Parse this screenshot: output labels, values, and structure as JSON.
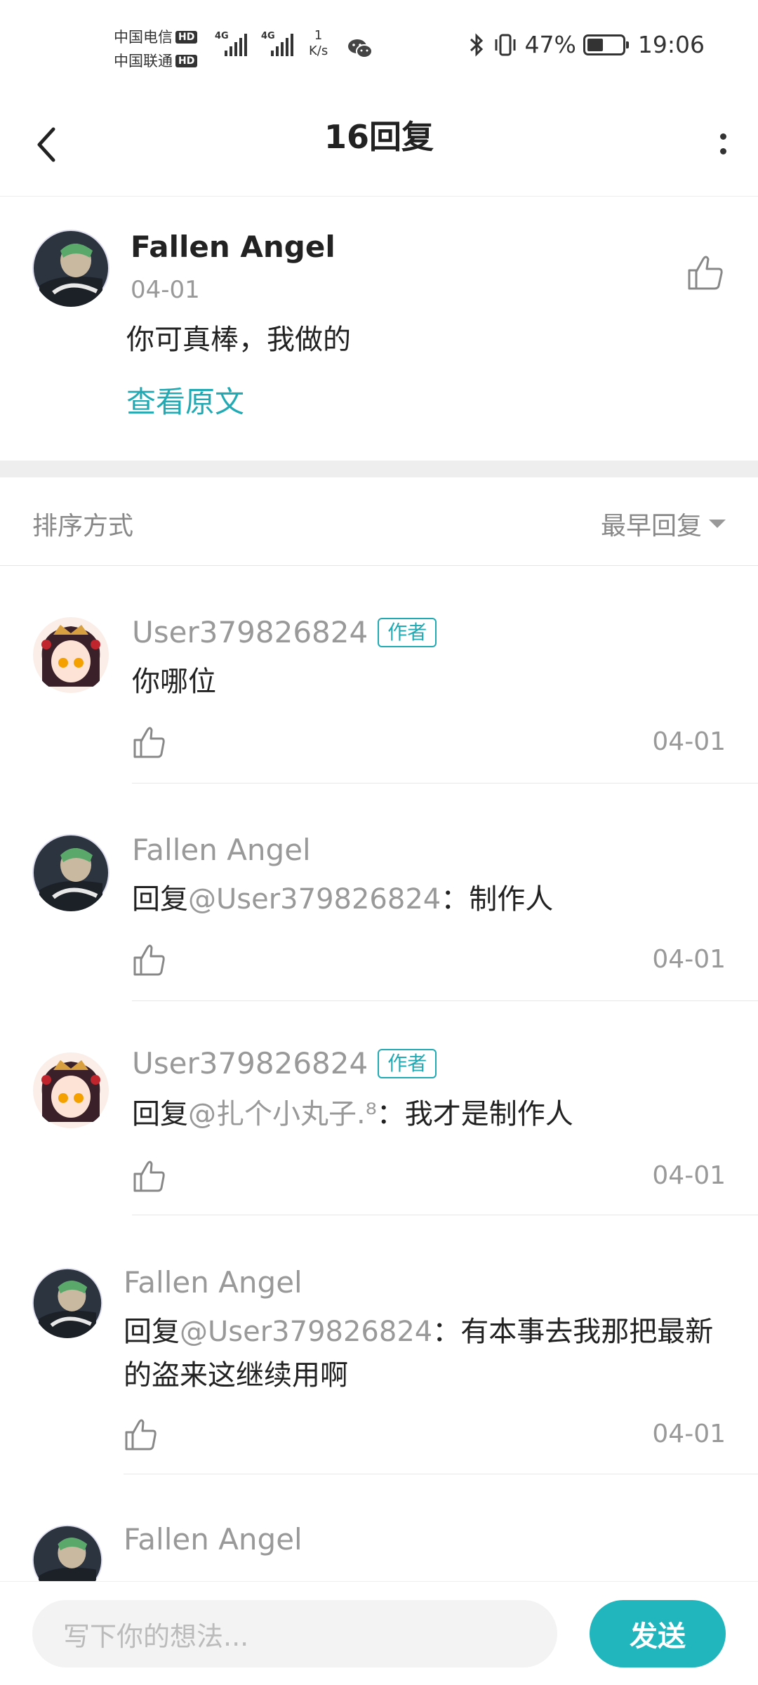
{
  "status_bar": {
    "carrier_1": "中国电信",
    "carrier_2": "中国联通",
    "hd": "HD",
    "network": "4G",
    "speed_value": "1",
    "speed_unit": "K/s",
    "battery": "47%",
    "battery_level": 0.47,
    "time": "19:06",
    "icons": [
      "wechat-icon",
      "bluetooth-icon",
      "vibrate-icon",
      "battery-icon"
    ]
  },
  "header": {
    "title": "16回复",
    "icons": [
      "back-arrow-icon",
      "more-vertical-icon"
    ]
  },
  "post": {
    "author": "Fallen Angel",
    "date": "04-01",
    "text": "你可真棒，我做的",
    "view_original": "查看原文"
  },
  "sort": {
    "label": "排序方式",
    "selected": "最早回复"
  },
  "replies": [
    {
      "name": "User379826824",
      "badge": "作者",
      "prefix": "",
      "mention": "",
      "text": "你哪位",
      "date": "04-01"
    },
    {
      "name": "Fallen Angel",
      "badge": "",
      "prefix": "回复",
      "mention": "@User379826824",
      "text": "：制作人",
      "date": "04-01"
    },
    {
      "name": "User379826824",
      "badge": "作者",
      "prefix": "回复",
      "mention": "@扎个小丸子.⁸",
      "text": "：我才是制作人",
      "date": "04-01"
    },
    {
      "name": "Fallen Angel",
      "badge": "",
      "prefix": "回复",
      "mention": "@User379826824",
      "text": "：有本事去我那把最新的盗来这继续用啊",
      "date": "04-01"
    },
    {
      "name": "Fallen Angel",
      "badge": "",
      "prefix": "",
      "mention": "",
      "text": "",
      "date": ""
    }
  ],
  "composer": {
    "placeholder": "写下你的想法...",
    "send_label": "发送"
  },
  "colors": {
    "accent": "#21aab3",
    "send_button": "#21b5bd",
    "muted_text": "#999999"
  }
}
